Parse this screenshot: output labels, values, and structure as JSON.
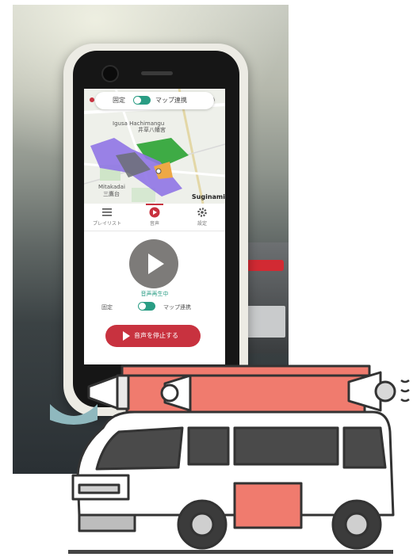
{
  "map_bar": {
    "left_label": "固定",
    "right_label": "マップ連携"
  },
  "map_labels": {
    "shrine": "Igusa Hachimangu",
    "shrine_jp": "井草八幡宮",
    "mitaka": "Mitakadai",
    "mitaka_jp": "三鷹台",
    "city": "Suginami"
  },
  "tabs": [
    {
      "label": "プレイリスト",
      "icon": "list-icon"
    },
    {
      "label": "音声",
      "icon": "play-circle-icon"
    },
    {
      "label": "設定",
      "icon": "gear-icon"
    }
  ],
  "player": {
    "status": "音声再生中",
    "fixed_label": "固定",
    "map_label": "マップ連携",
    "stop_label": "音声を停止する"
  },
  "colors": {
    "accent_red": "#c8323f",
    "accent_green": "#2a9d84",
    "van_salmon": "#f07b6e"
  }
}
